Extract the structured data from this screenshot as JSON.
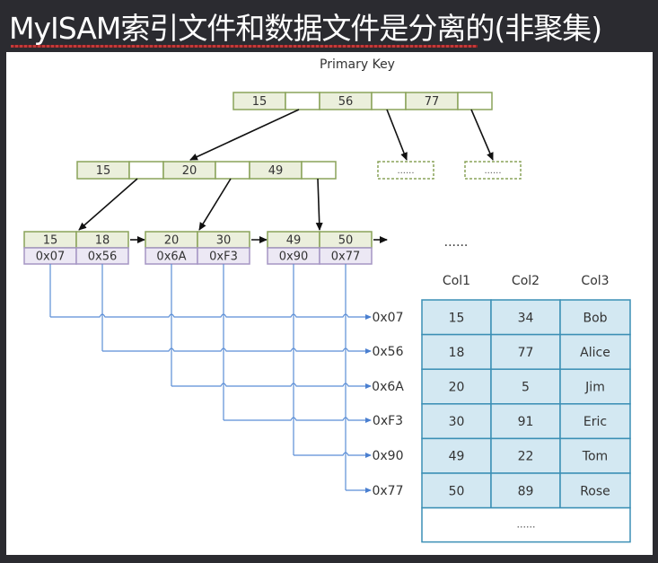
{
  "title": "MyISAM索引文件和数据文件是分离的(非聚集)",
  "diagram": {
    "label": "Primary Key",
    "root": {
      "keys": [
        "15",
        "56",
        "77"
      ]
    },
    "internal": {
      "keys": [
        "15",
        "20",
        "49"
      ]
    },
    "placeholder_nodes": [
      "......",
      "......"
    ],
    "leaves": [
      {
        "keys": [
          "15",
          "18"
        ],
        "pointers": [
          "0x07",
          "0x56"
        ]
      },
      {
        "keys": [
          "20",
          "30"
        ],
        "pointers": [
          "0x6A",
          "0xF3"
        ]
      },
      {
        "keys": [
          "49",
          "50"
        ],
        "pointers": [
          "0x90",
          "0x77"
        ]
      }
    ],
    "leaf_ellipsis": "......",
    "address_labels": [
      "0x07",
      "0x56",
      "0x6A",
      "0xF3",
      "0x90",
      "0x77"
    ],
    "table": {
      "columns": [
        "Col1",
        "Col2",
        "Col3"
      ],
      "rows": [
        [
          "15",
          "34",
          "Bob"
        ],
        [
          "18",
          "77",
          "Alice"
        ],
        [
          "20",
          "5",
          "Jim"
        ],
        [
          "30",
          "91",
          "Eric"
        ],
        [
          "49",
          "22",
          "Tom"
        ],
        [
          "50",
          "89",
          "Rose"
        ]
      ],
      "footer": "......"
    },
    "colors": {
      "key_cell": "#ebefdc",
      "key_border": "#8aa35a",
      "pointer_cell": "#ece8f4",
      "pointer_border": "#a596c4",
      "table_cell": "#d3e8f2",
      "table_border": "#3b8fb5",
      "link_line": "#5b8ed6"
    }
  }
}
